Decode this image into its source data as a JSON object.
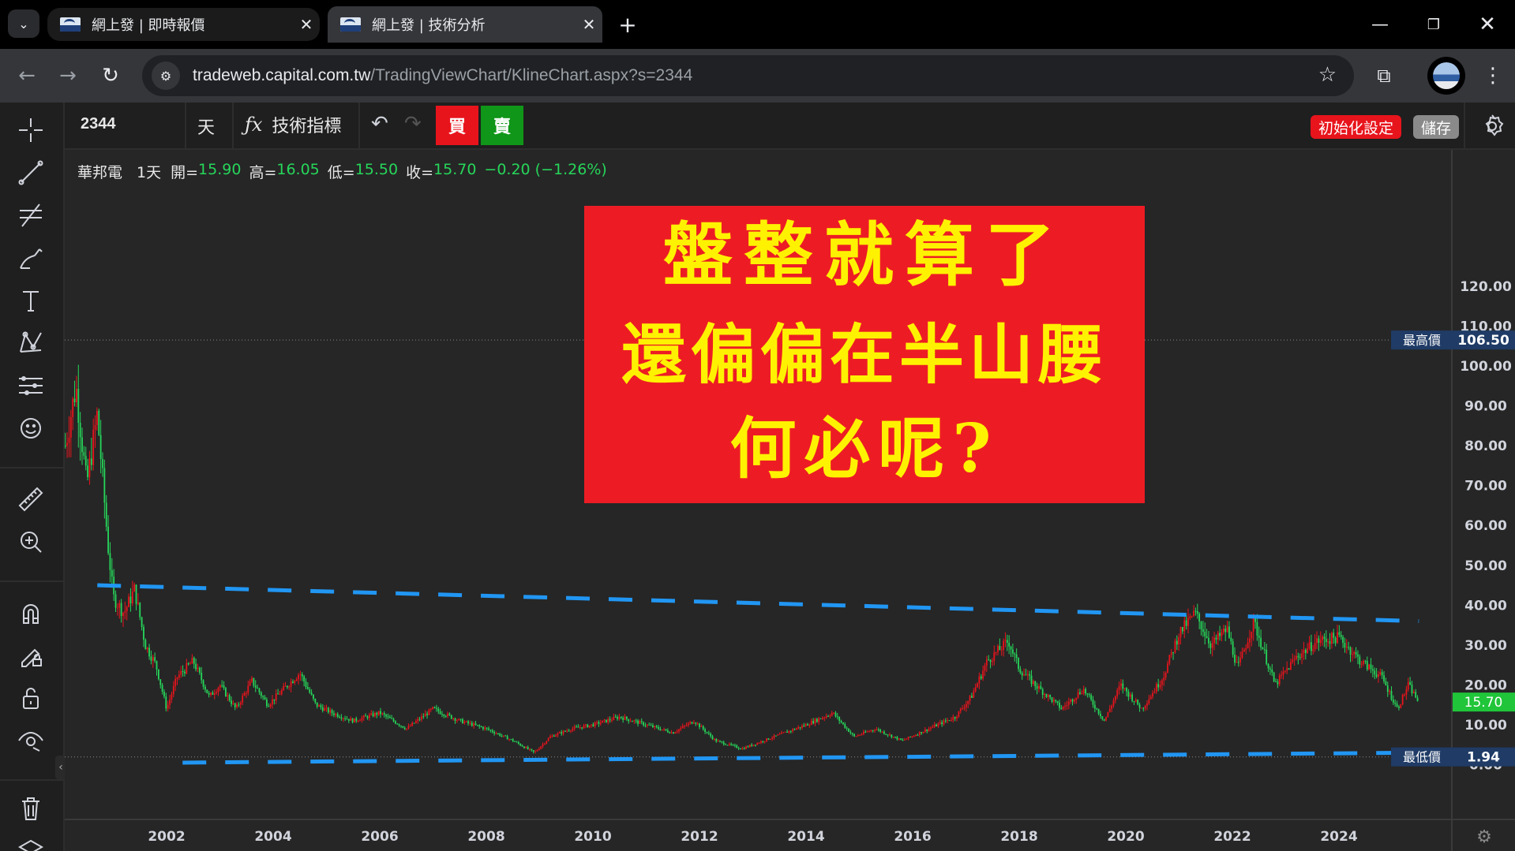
{
  "browser": {
    "tabs": [
      {
        "title": "網上發 | 即時報價"
      },
      {
        "title": "網上發 | 技術分析"
      }
    ],
    "url_host": "tradeweb.capital.com.tw",
    "url_path": "/TradingViewChart/KlineChart.aspx?s=2344"
  },
  "toolbar": {
    "symbol": "2344",
    "interval": "天",
    "indicators_label": "技術指標",
    "buy_label": "買",
    "sell_label": "賣",
    "reset_label": "初始化設定",
    "save_label": "儲存"
  },
  "legend": {
    "name": "華邦電",
    "interval": "1天",
    "open_label": "開=",
    "open": "15.90",
    "high_label": "高=",
    "high": "16.05",
    "low_label": "低=",
    "low": "15.50",
    "close_label": "收=",
    "close": "15.70",
    "change": "−0.20 (−1.26%)"
  },
  "annotation": {
    "lines": [
      "盤整就算了",
      "還偏偏在半山腰",
      "何必呢?"
    ],
    "bg": "#ed1c24",
    "fg": "#fff200"
  },
  "colors": {
    "up": "#e8141c",
    "down": "#26d65a",
    "trend": "#2196f3",
    "last": "#20c53a"
  },
  "chart_data": {
    "type": "line",
    "x_ticks": [
      "2002",
      "2004",
      "2006",
      "2008",
      "2010",
      "2012",
      "2014",
      "2016",
      "2018",
      "2020",
      "2022",
      "2024"
    ],
    "y_ticks": [
      "0.00",
      "10.00",
      "20.00",
      "30.00",
      "40.00",
      "50.00",
      "60.00",
      "70.00",
      "80.00",
      "90.00",
      "100.00",
      "110.00",
      "120.00"
    ],
    "ylim": [
      0,
      125
    ],
    "high_label": "最高價",
    "high_value": "106.50",
    "low_label": "最低價",
    "low_value": "1.94",
    "last_value": "15.70",
    "series": [
      {
        "x": [
          2000.1,
          2000.3,
          2000.5,
          2000.7,
          2000.9,
          2001.0,
          2001.2,
          2001.4,
          2001.6,
          2001.8,
          2002.0,
          2002.2,
          2002.5,
          2002.8,
          2003.0,
          2003.3,
          2003.6,
          2003.9,
          2004.2,
          2004.5,
          2004.8,
          2005.1,
          2005.5,
          2006.0,
          2006.5,
          2007.0,
          2007.5,
          2008.0,
          2008.5,
          2008.9,
          2009.2,
          2009.6,
          2010.0,
          2010.5,
          2011.0,
          2011.5,
          2011.9,
          2012.3,
          2012.8,
          2013.2,
          2013.6,
          2014.0,
          2014.5,
          2014.9,
          2015.3,
          2015.8,
          2016.3,
          2016.8,
          2017.1,
          2017.4,
          2017.8,
          2018.0,
          2018.3,
          2018.8,
          2019.2,
          2019.6,
          2019.9,
          2020.3,
          2020.7,
          2021.0,
          2021.3,
          2021.6,
          2021.9,
          2022.1,
          2022.4,
          2022.8,
          2023.2,
          2023.6,
          2024.0,
          2024.4,
          2024.8,
          2025.1,
          2025.3,
          2025.5
        ],
        "y": [
          80,
          95,
          70,
          88,
          55,
          42,
          38,
          44,
          30,
          25,
          14,
          22,
          26,
          17,
          20,
          14,
          21,
          15,
          19,
          23,
          15,
          13,
          11,
          13,
          9,
          14,
          11,
          9,
          6,
          3,
          7,
          9,
          10,
          12,
          10,
          8,
          11,
          6,
          4,
          6,
          8,
          10,
          13,
          7,
          9,
          6,
          9,
          12,
          17,
          26,
          31,
          24,
          20,
          14,
          19,
          11,
          20,
          14,
          22,
          33,
          38,
          30,
          34,
          24,
          36,
          20,
          27,
          31,
          32,
          26,
          22,
          14,
          20,
          15.7
        ]
      }
    ],
    "trendlines": [
      {
        "x": [
          2000.7,
          2025.5
        ],
        "y": [
          45,
          36
        ]
      },
      {
        "x": [
          2002.3,
          2025.5
        ],
        "y": [
          0.5,
          3
        ]
      }
    ]
  }
}
